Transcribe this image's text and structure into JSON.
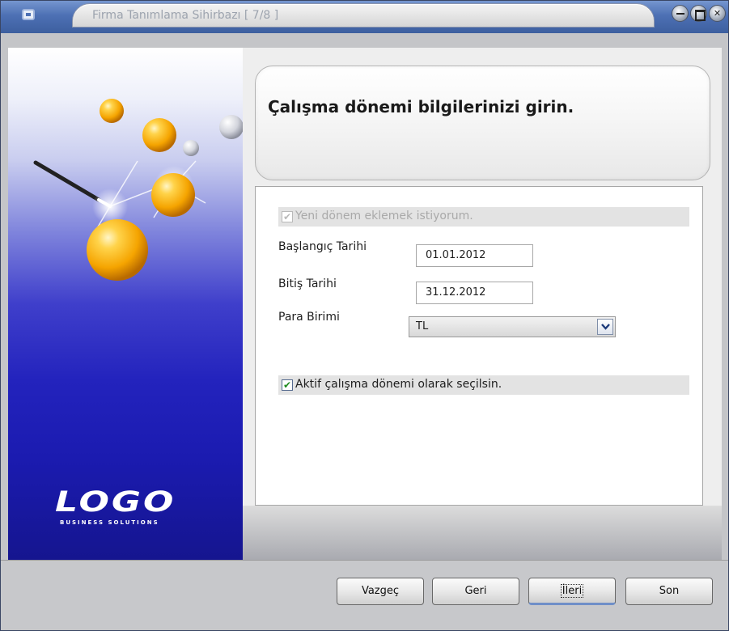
{
  "window": {
    "title": "Firma Tanımlama Sihirbazı [ 7/8 ]"
  },
  "branding": {
    "logo": "LOGO",
    "tagline": "BUSINESS SOLUTIONS"
  },
  "header": {
    "title": "Çalışma dönemi bilgilerinizi girin."
  },
  "form": {
    "new_period_checkbox": {
      "label": "Yeni dönem eklemek istiyorum.",
      "checked": true,
      "enabled": false
    },
    "start_date": {
      "label": "Başlangıç Tarihi",
      "value": "01.01.2012"
    },
    "end_date": {
      "label": "Bitiş Tarihi",
      "value": "31.12.2012"
    },
    "currency": {
      "label": "Para Birimi",
      "selected": "TL"
    },
    "active_period_checkbox": {
      "label": "Aktif çalışma dönemi olarak seçilsin.",
      "checked": true
    }
  },
  "buttons": {
    "cancel": "Vazgeç",
    "back": "Geri",
    "next": "İleri",
    "finish": "Son"
  },
  "colors": {
    "titlebar": "#4d70b4",
    "panel_blue": "#2323bd",
    "check_green": "#1e8a1e"
  }
}
